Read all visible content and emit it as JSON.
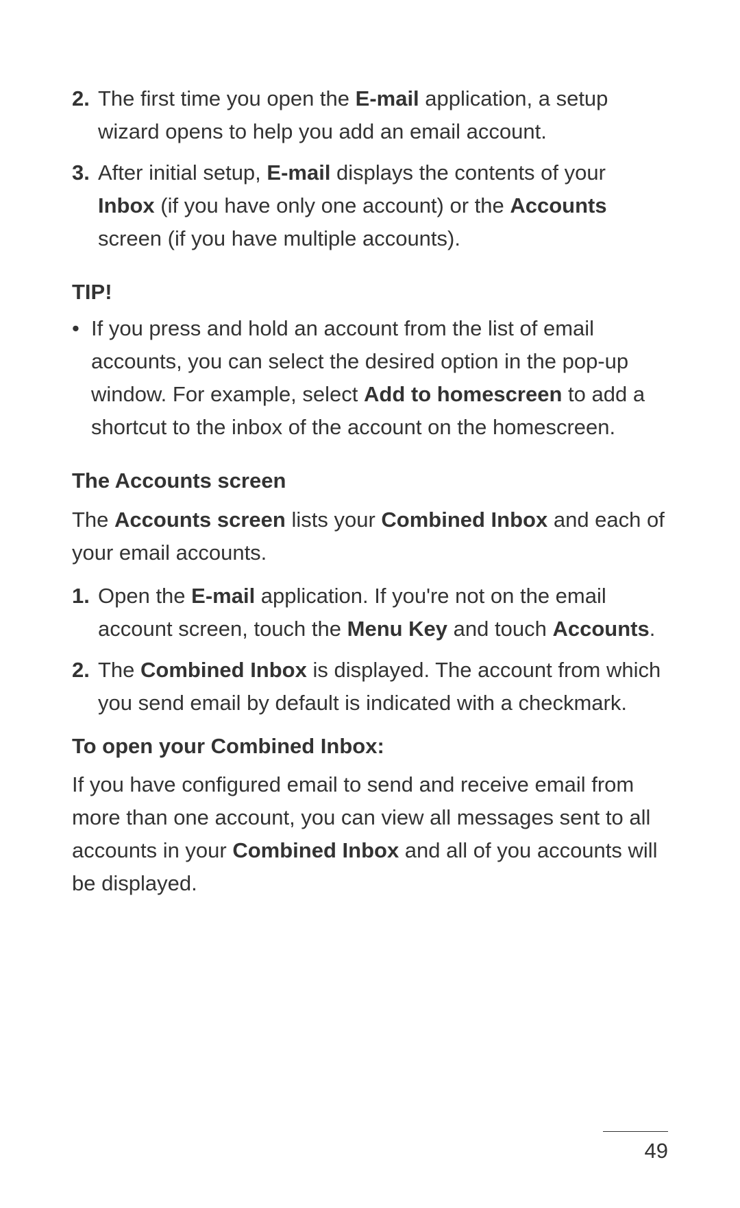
{
  "steps_top": [
    {
      "num": "2.",
      "pre": "The first time you open the ",
      "b1": "E-mail",
      "post": " application, a setup wizard opens to help you add an email account."
    },
    {
      "num": "3.",
      "t1": "After initial setup, ",
      "b1": "E-mail",
      "t2": " displays the contents of your ",
      "b2": "Inbox",
      "t3": " (if you have only one account) or the ",
      "b3": "Accounts",
      "t4": " screen (if you have multiple accounts)."
    }
  ],
  "tip": {
    "heading": "TIP!",
    "bullet": "•",
    "t1": "If you press and hold an account from the list of email accounts, you can select the desired option in the pop-up window. For example, select ",
    "b1": "Add to homescreen",
    "t2": " to add a shortcut to the inbox of the account on the homescreen."
  },
  "accounts": {
    "heading": "The Accounts screen",
    "intro_t1": "The ",
    "intro_b1": "Accounts screen",
    "intro_t2": " lists your ",
    "intro_b2": "Combined Inbox",
    "intro_t3": " and each of your email accounts.",
    "step1": {
      "num": "1.",
      "t1": " Open the ",
      "b1": "E-mail",
      "t2": " application. If you're not on the email account screen, touch the ",
      "b2": "Menu Key",
      "t3": " and touch ",
      "b3": "Accounts",
      "t4": "."
    },
    "step2": {
      "num": "2.",
      "t1": "The ",
      "b1": "Combined Inbox",
      "t2": " is displayed. The account from which you send email by default is indicated with a checkmark."
    }
  },
  "combined": {
    "heading": "To open your Combined Inbox:",
    "t1": "If you have configured email to send and receive email from more than one account, you can view all messages sent to all accounts in your ",
    "b1": "Combined Inbox",
    "t2": " and all of you accounts will be displayed."
  },
  "page_number": "49"
}
